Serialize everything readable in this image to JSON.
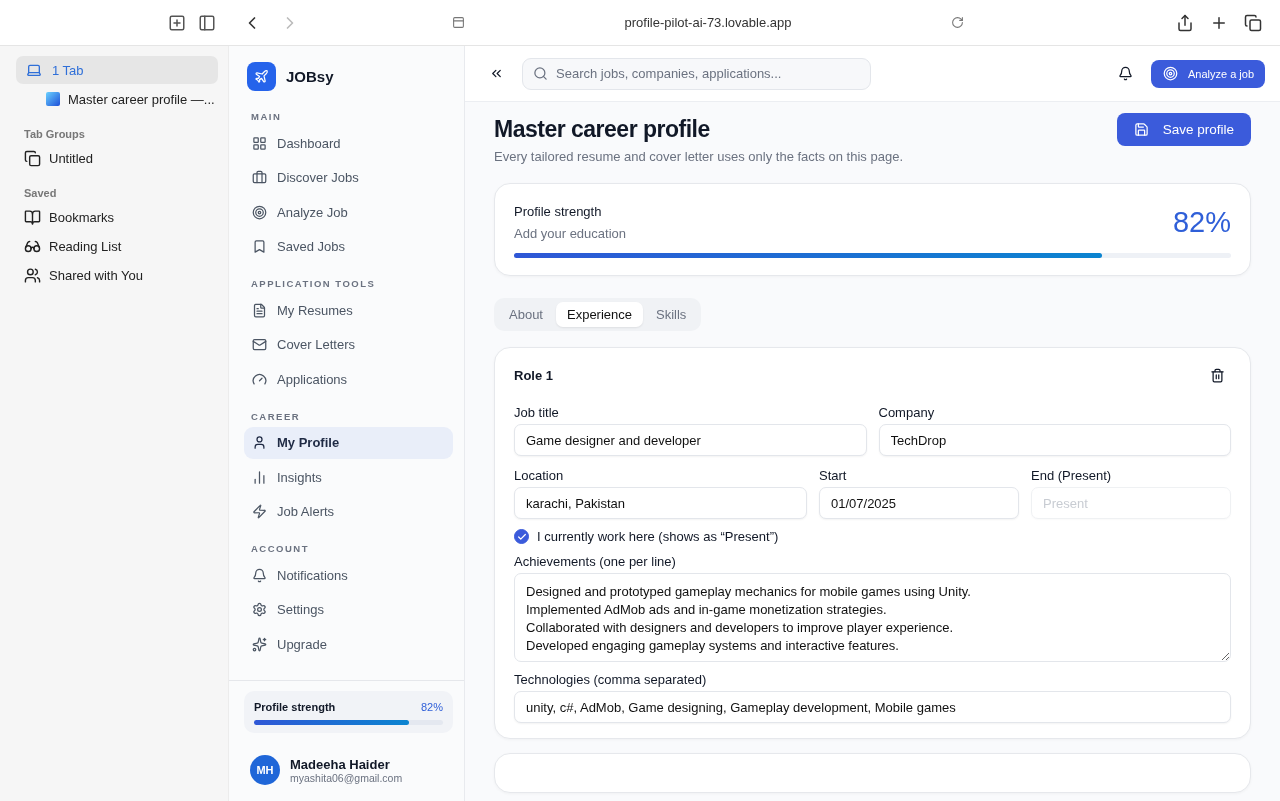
{
  "browser": {
    "address": "profile-pilot-ai-73.lovable.app"
  },
  "browser_sidebar": {
    "tab_group": {
      "label": "1 Tab",
      "selected": true
    },
    "tabs": [
      {
        "title": "Master career profile —...",
        "selected": false
      }
    ],
    "sections": [
      {
        "heading": "Tab Groups",
        "items": [
          {
            "label": "Untitled"
          }
        ]
      },
      {
        "heading": "Saved",
        "items": [
          {
            "label": "Bookmarks"
          },
          {
            "label": "Reading List"
          },
          {
            "label": "Shared with You"
          }
        ]
      }
    ]
  },
  "app_sidebar": {
    "brand": "JOBsy",
    "nav_sections": [
      {
        "heading": "MAIN",
        "items": [
          {
            "label": "Dashboard",
            "selected": false
          },
          {
            "label": "Discover Jobs",
            "selected": false
          },
          {
            "label": "Analyze Job",
            "selected": false
          },
          {
            "label": "Saved Jobs",
            "selected": false
          }
        ]
      },
      {
        "heading": "APPLICATION TOOLS",
        "items": [
          {
            "label": "My Resumes",
            "selected": false
          },
          {
            "label": "Cover Letters",
            "selected": false
          },
          {
            "label": "Applications",
            "selected": false
          }
        ]
      },
      {
        "heading": "CAREER",
        "items": [
          {
            "label": "My Profile",
            "selected": true
          },
          {
            "label": "Insights",
            "selected": false
          },
          {
            "label": "Job Alerts",
            "selected": false
          }
        ]
      },
      {
        "heading": "ACCOUNT",
        "items": [
          {
            "label": "Notifications",
            "selected": false
          },
          {
            "label": "Settings",
            "selected": false
          },
          {
            "label": "Upgrade",
            "selected": false
          }
        ]
      }
    ],
    "strength": {
      "label": "Profile strength",
      "value": "82%",
      "level": 0.82
    },
    "user": {
      "initials": "MH",
      "name": "Madeeha Haider",
      "email": "myashita06@gmail.com"
    }
  },
  "topbar": {
    "search_placeholder": "Search jobs, companies, applications...",
    "analyze_button": "Analyze a job"
  },
  "page": {
    "title": "Master career profile",
    "subtitle": "Every tailored resume and cover letter uses only the facts on this page.",
    "save_button": "Save profile",
    "strength": {
      "label": "Profile strength",
      "hint": "Add your education",
      "value": "82%",
      "level": 0.82
    },
    "tabs": [
      {
        "label": "About",
        "selected": false
      },
      {
        "label": "Experience",
        "selected": true
      },
      {
        "label": "Skills",
        "selected": false
      }
    ],
    "role": {
      "title": "Role 1",
      "job_title": {
        "label": "Job title",
        "value": "Game designer and developer"
      },
      "company": {
        "label": "Company",
        "value": "TechDrop"
      },
      "location": {
        "label": "Location",
        "value": "karachi, Pakistan"
      },
      "start": {
        "label": "Start",
        "value": "01/07/2025"
      },
      "end": {
        "label": "End (Present)",
        "placeholder": "Present",
        "disabled": true
      },
      "current": {
        "label": "I currently work here (shows as “Present”)",
        "checked": true
      },
      "achievements": {
        "label": "Achievements (one per line)",
        "lines": [
          "Designed and prototyped gameplay mechanics for mobile games using Unity.",
          "Implemented AdMob ads and in-game monetization strategies.",
          "Collaborated with designers and developers to improve player experience.",
          "Developed engaging gameplay systems and interactive features."
        ]
      },
      "technologies": {
        "label": "Technologies (comma separated)",
        "value": "unity, c#, AdMob, Game designing, Gameplay development, Mobile games"
      }
    }
  }
}
